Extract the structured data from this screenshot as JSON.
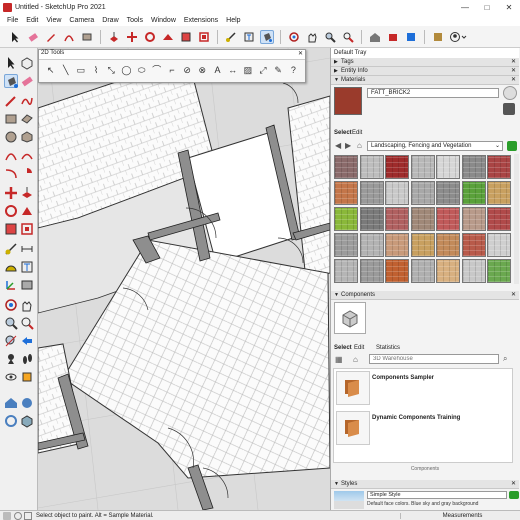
{
  "window": {
    "title": "Untitled - SketchUp Pro 2021",
    "min": "—",
    "max": "□",
    "close": "✕"
  },
  "menu": [
    "File",
    "Edit",
    "View",
    "Camera",
    "Draw",
    "Tools",
    "Window",
    "Extensions",
    "Help"
  ],
  "tools2d": {
    "title": "2D Tools",
    "close": "✕"
  },
  "tray": {
    "title": "Default Tray",
    "tags": "Tags",
    "entity_info": "Entity Info",
    "materials": "Materials",
    "material_name": "FATT_BRICK2",
    "tabs": {
      "select": "Select",
      "edit": "Edit"
    },
    "library": "Landscaping, Fencing and Vegetation",
    "components": "Components",
    "comp_tabs": {
      "select": "Select",
      "edit": "Edit",
      "statistics": "Statistics"
    },
    "comp_search_placeholder": "3D Warehouse",
    "comp_items": [
      {
        "name": "Components Sampler"
      },
      {
        "name": "Dynamic Components Training"
      }
    ],
    "comp_footer": "Components",
    "styles": "Styles",
    "style_name": "Simple Style",
    "style_desc": "Default face colors. Blue sky and gray background"
  },
  "status": {
    "text": "Select object to paint. Alt = Sample Material.",
    "measurements": "Measurements"
  },
  "colors": {
    "accent": "#1e6fd9",
    "red": "#c62828",
    "grid_bg": "#dcdcdc"
  }
}
